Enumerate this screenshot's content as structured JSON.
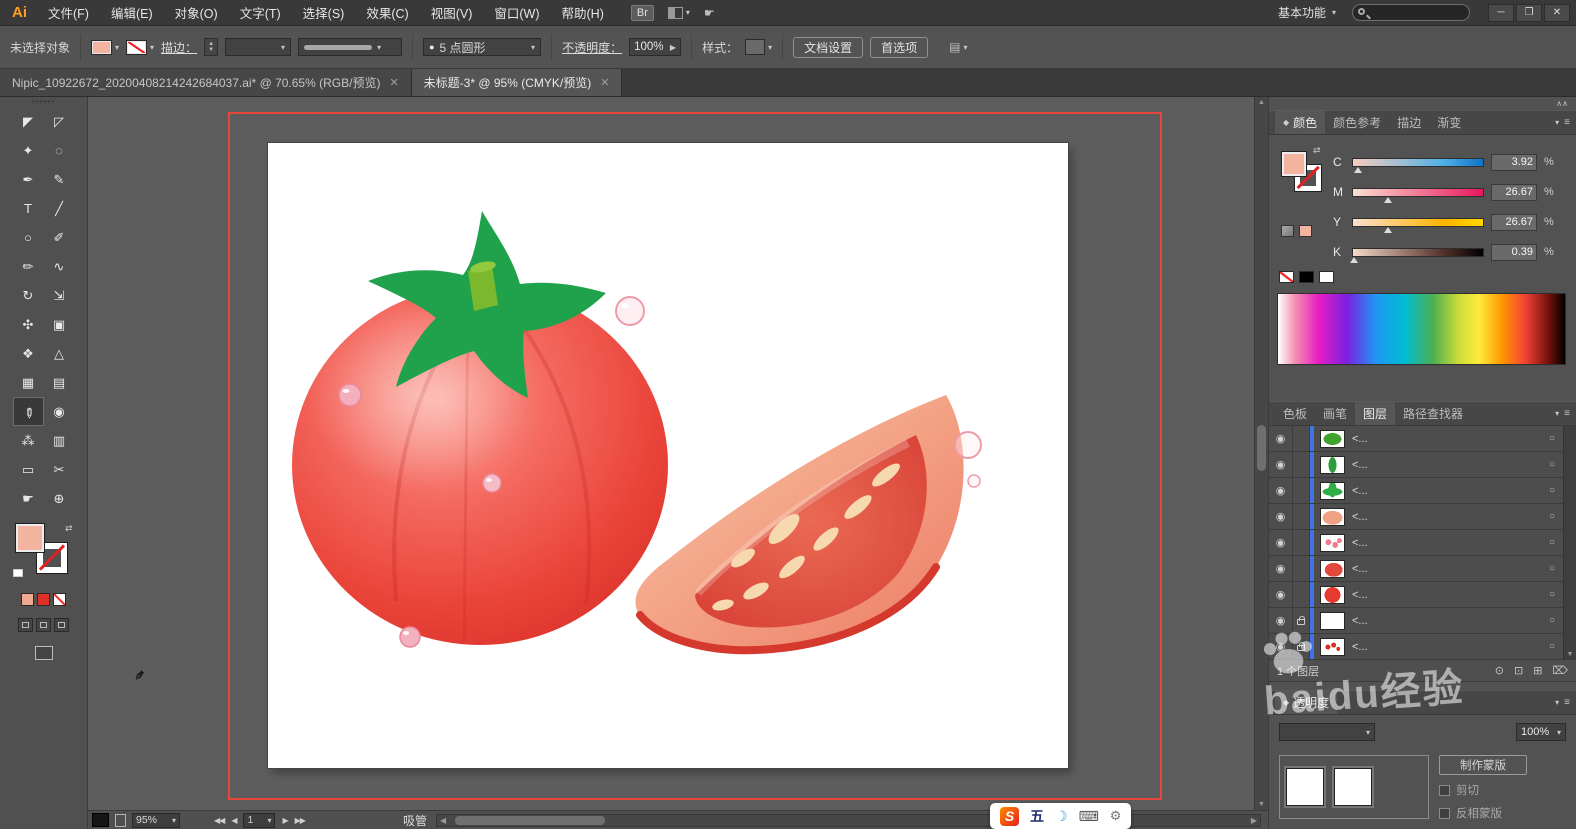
{
  "colors": {
    "accent_orange": "#ff9c21",
    "fill_peach": "#f2b49e",
    "layer_selection_blue": "#3f74e8",
    "artboard_outline_red": "#e5473a"
  },
  "icons": {
    "selection": "◤",
    "direct_selection": "◸",
    "magic_wand": "✦",
    "lasso": "◌",
    "pen": "✒",
    "curvature_pen": "✎",
    "type_tool": "T",
    "line_segment": "╱",
    "ellipse": "○",
    "paintbrush": "✐",
    "pencil": "✏",
    "smooth": "∿",
    "rotate": "↻",
    "scale": "⇲",
    "width_tool": "✣",
    "free_transform": "▣",
    "shape_builder": "❖",
    "perspective_grid": "△",
    "mesh": "▦",
    "gradient": "▤",
    "eyedropper": "✐",
    "blend": "◉",
    "symbol_sprayer": "⁂",
    "column_graph": "▥",
    "artboard_tool": "▭",
    "slice": "✂",
    "hand": "☛",
    "zoom_tool": "⊕",
    "eye": "◉",
    "target": "○",
    "close": "✕",
    "minimize": "─",
    "restore": "❐",
    "dropdown": "▾",
    "up": "▲",
    "down": "▼",
    "left": "◀",
    "right": "▶",
    "double_left": "◀◀",
    "double_right": "▶▶",
    "swap": "⇄",
    "menu": "≡",
    "collapse": "∧∧",
    "diamond": "◆",
    "bullet": "●",
    "moon": "☽",
    "keyboard": "⌨",
    "wrench": "⚙",
    "make_clip": "⊙",
    "new_sublayer": "⊡",
    "new_layer": "⊞",
    "delete": "⌦",
    "cursor": "✒"
  },
  "titlebar": {
    "logo": "Ai",
    "menus": [
      "文件(F)",
      "编辑(E)",
      "对象(O)",
      "文字(T)",
      "选择(S)",
      "效果(C)",
      "视图(V)",
      "窗口(W)",
      "帮助(H)"
    ],
    "br": "Br",
    "workspace": "基本功能",
    "search_placeholder": ""
  },
  "controlbar": {
    "status": "未选择对象",
    "stroke_label": "描边：",
    "brush_name": "5 点圆形",
    "opacity_label": "不透明度：",
    "opacity_value": "100%",
    "style_label": "样式：",
    "doc_setup": "文档设置",
    "preferences": "首选项"
  },
  "tabs": [
    {
      "label": "Nipic_10922672_20200408214242684037.ai* @ 70.65% (RGB/预览)"
    },
    {
      "label": "未标题-3* @ 95% (CMYK/预览)"
    }
  ],
  "color_panel": {
    "tabs": [
      "颜色",
      "颜色参考",
      "描边",
      "渐变"
    ],
    "channels": [
      {
        "label": "C",
        "value": "3.92",
        "unit": "%"
      },
      {
        "label": "M",
        "value": "26.67",
        "unit": "%"
      },
      {
        "label": "Y",
        "value": "26.67",
        "unit": "%"
      },
      {
        "label": "K",
        "value": "0.39",
        "unit": "%"
      }
    ]
  },
  "panel_tabs": [
    "色板",
    "画笔",
    "图层",
    "路径查找器"
  ],
  "layers": {
    "rows": [
      {
        "label": "<...",
        "thumb": "green-leaf"
      },
      {
        "label": "<...",
        "thumb": "green-stem"
      },
      {
        "label": "<...",
        "thumb": "green-calyx"
      },
      {
        "label": "<...",
        "thumb": "tomato-slice"
      },
      {
        "label": "<...",
        "thumb": "pink-drops"
      },
      {
        "label": "<...",
        "thumb": "red-wedge"
      },
      {
        "label": "<...",
        "thumb": "red-tomato"
      },
      {
        "label": "<...",
        "thumb": "white"
      },
      {
        "label": "<...",
        "thumb": "red-dots"
      }
    ],
    "footer": "1 个图层"
  },
  "transparency": {
    "title": "透明度",
    "opacity": "100%",
    "make_mask": "制作蒙版",
    "clip": "剪切",
    "invert_mask": "反相蒙版"
  },
  "statusbar": {
    "zoom": "95%",
    "artboard": "1",
    "tool": "吸管"
  },
  "ime": {
    "logo": "S",
    "lang": "五"
  },
  "watermark": "baidu经验"
}
